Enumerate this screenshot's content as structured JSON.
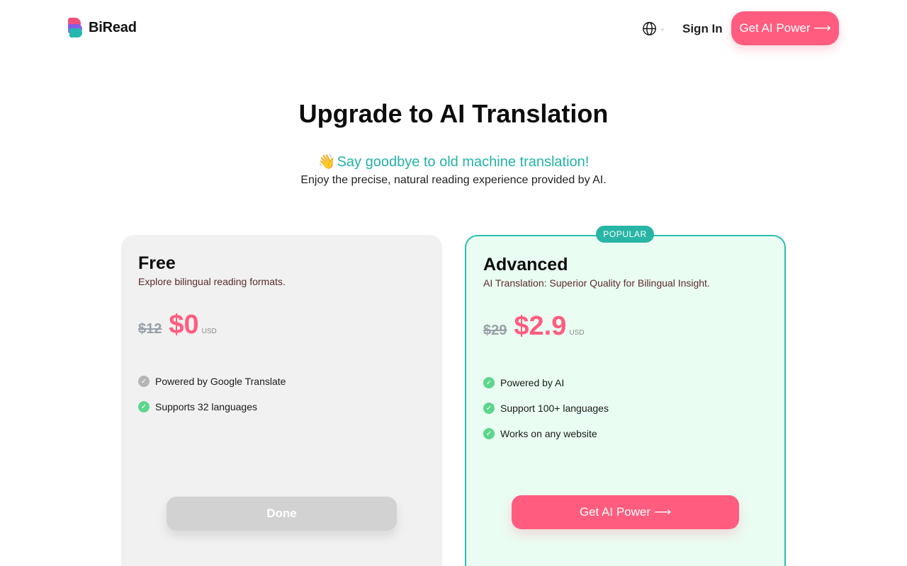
{
  "header": {
    "brand": "BiRead",
    "language_icon": "globe-icon",
    "signin_label": "Sign In",
    "cta_label": "Get AI Power ⟶"
  },
  "hero": {
    "emoji": "👋",
    "title": "Upgrade to AI Translation",
    "subtitle": "Say goodbye to old machine translation!",
    "description": "Enjoy the precise, natural reading experience provided by AI."
  },
  "plans": [
    {
      "name": "Free",
      "tagline": "Explore bilingual reading formats.",
      "old_price": "$12",
      "price": "$0",
      "currency": "USD",
      "features": [
        {
          "text": "Powered by Google Translate",
          "check": "gray"
        },
        {
          "text": "Supports 32 languages",
          "check": "green"
        }
      ],
      "button_label": "Done"
    },
    {
      "name": "Advanced",
      "badge": "POPULAR",
      "tagline": "AI Translation: Superior Quality for Bilingual Insight.",
      "old_price": "$29",
      "price": "$2.9",
      "currency": "USD",
      "features": [
        {
          "text": "Powered by AI",
          "check": "green"
        },
        {
          "text": "Support 100+ languages",
          "check": "green"
        },
        {
          "text": "Works on any website",
          "check": "green"
        }
      ],
      "button_label": "Get AI Power ⟶"
    }
  ],
  "colors": {
    "accent_pink": "#ff5c7f",
    "accent_teal": "#28b5a5",
    "check_green": "#5dd68d",
    "free_card_bg": "#f1f1f1",
    "advanced_card_bg": "#eafdf2"
  }
}
